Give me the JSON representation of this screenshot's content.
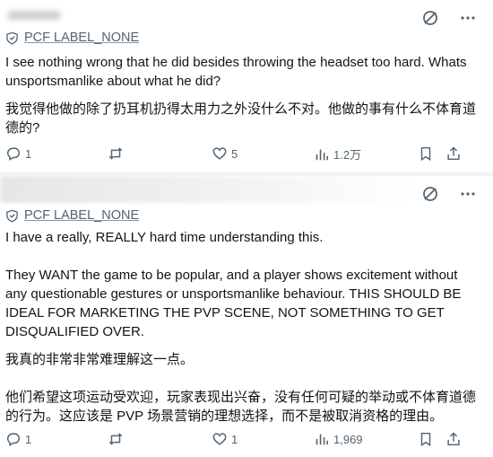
{
  "tweets": [
    {
      "handle": "PCF LABEL_NONE",
      "paragraphs": [
        "I see nothing wrong that he did besides throwing the headset too hard. Whats unsportsmanlike about what he did?",
        "我觉得他做的除了扔耳机扔得太用力之外没什么不对。他做的事有什么不体育道德的?"
      ],
      "stats": {
        "replies": "1",
        "retweets": "",
        "likes": "5",
        "views": "1.2万"
      }
    },
    {
      "handle": "PCF LABEL_NONE",
      "paragraphs": [
        "I have a really, REALLY hard time understanding this.",
        "They WANT the game to be popular, and a player shows excitement without any questionable gestures or unsportsmanlike behaviour. THIS SHOULD BE IDEAL FOR MARKETING THE PVP SCENE, NOT SOMETHING TO GET DISQUALIFIED OVER.",
        "我真的非常非常难理解这一点。",
        "他们希望这项运动受欢迎，玩家表现出兴奋，没有任何可疑的举动或不体育道德的行为。这应该是 PVP 场景营销的理想选择，而不是被取消资格的理由。"
      ],
      "stats": {
        "replies": "1",
        "retweets": "",
        "likes": "1",
        "views": "1,969"
      }
    }
  ],
  "icons": {
    "grok": "grok-slash-circle-icon",
    "more": "more-dots-icon",
    "shield": "shield-icon",
    "reply": "reply-bubble-icon",
    "retweet": "retweet-icon",
    "like": "heart-icon",
    "views": "views-bars-icon",
    "bookmark": "bookmark-icon",
    "share": "share-upload-icon"
  },
  "colors": {
    "text": "#0f1419",
    "muted": "#536471",
    "separator": "#f3f4f5"
  }
}
